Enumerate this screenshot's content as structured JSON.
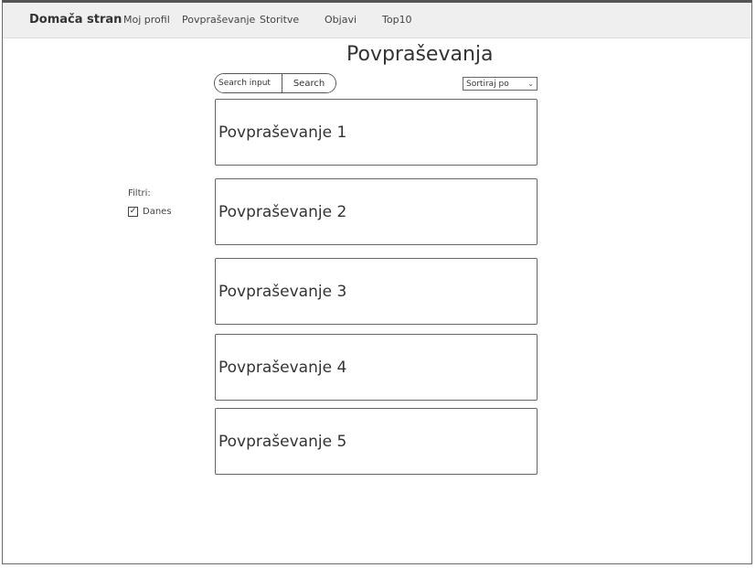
{
  "nav": {
    "brand": "Domača stran",
    "items": [
      {
        "label": "Moj profil"
      },
      {
        "label": "Povpraševanje"
      },
      {
        "label": "Storitve"
      },
      {
        "label": "Objavi"
      },
      {
        "label": "Top10"
      }
    ]
  },
  "page": {
    "title": "Povpraševanja"
  },
  "search": {
    "placeholder": "Search input",
    "button_label": "Search"
  },
  "sort": {
    "selected": "Sortiraj po"
  },
  "filters": {
    "label": "Filtri:",
    "options": [
      {
        "label": "Danes",
        "checked": true
      }
    ]
  },
  "cards": [
    {
      "title": "Povpraševanje 1"
    },
    {
      "title": "Povpraševanje 2"
    },
    {
      "title": "Povpraševanje 3"
    },
    {
      "title": "Povpraševanje 4"
    },
    {
      "title": "Povpraševanje 5"
    }
  ],
  "colors": {
    "navbar_bg": "#efefef",
    "border": "#666666"
  }
}
